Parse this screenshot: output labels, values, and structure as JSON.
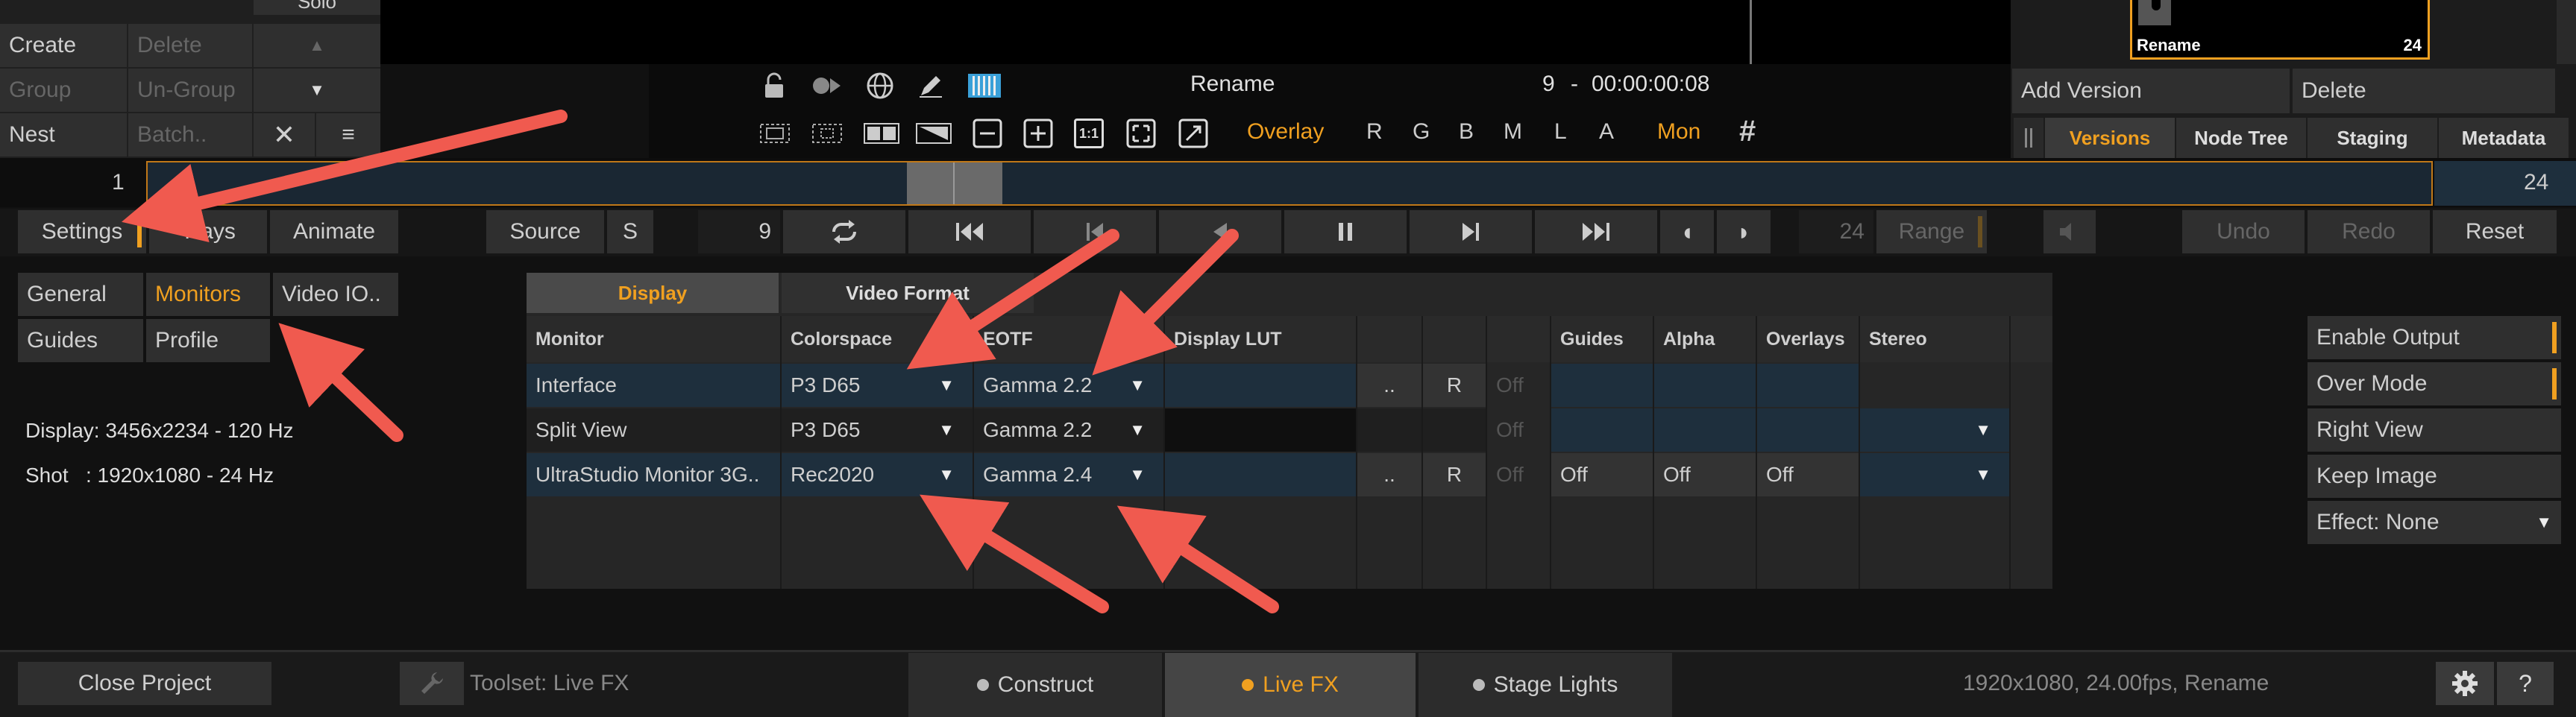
{
  "left_panel": {
    "solo": "Solo",
    "create": "Create",
    "delete": "Delete",
    "group": "Group",
    "ungroup": "Un-Group",
    "nest": "Nest",
    "batch": "Batch.."
  },
  "toolbar": {
    "clip_name": "Rename",
    "frame_number": "9",
    "separator": "-",
    "timecode": "00:00:00:08",
    "overlay": "Overlay",
    "channels": [
      "R",
      "G",
      "B",
      "M",
      "L",
      "A"
    ],
    "mon": "Mon",
    "ratio_label": "1:1"
  },
  "right_panel": {
    "thumb_name": "Rename",
    "thumb_count": "24",
    "add_version": "Add Version",
    "delete": "Delete",
    "tabs": [
      "Versions",
      "Node Tree",
      "Staging",
      "Metadata"
    ]
  },
  "timeline": {
    "start": "1",
    "end": "24"
  },
  "transport": {
    "settings": "Settings",
    "trays": "Trays",
    "animate": "Animate",
    "source": "Source",
    "s": "S",
    "frame": "9",
    "end_frame": "24",
    "range": "Range",
    "undo": "Undo",
    "redo": "Redo",
    "reset": "Reset"
  },
  "settings_tabs": {
    "general": "General",
    "monitors": "Monitors",
    "video_io": "Video IO..",
    "guides": "Guides",
    "profile": "Profile"
  },
  "info": {
    "display": "Display: 3456x2234 - 120 Hz",
    "shot": "Shot   : 1920x1080 - 24 Hz"
  },
  "monitor_table": {
    "tabs": [
      "Display",
      "Video Format"
    ],
    "headers": [
      "Monitor",
      "Colorspace",
      "EOTF",
      "Display LUT",
      "Guides",
      "Alpha",
      "Overlays",
      "Stereo"
    ],
    "rows": [
      {
        "monitor": "Interface",
        "colorspace": "P3 D65",
        "eotf": "Gamma 2.2",
        "dots": "..",
        "r": "R",
        "off": "Off",
        "guides": "",
        "alpha": "",
        "overlays": ""
      },
      {
        "monitor": "Split View",
        "colorspace": "P3 D65",
        "eotf": "Gamma 2.2",
        "dots": "",
        "r": "",
        "off": "Off",
        "guides": "",
        "alpha": "",
        "overlays": ""
      },
      {
        "monitor": "UltraStudio Monitor 3G..",
        "colorspace": "Rec2020",
        "eotf": "Gamma 2.4",
        "dots": "..",
        "r": "R",
        "off": "Off",
        "guides": "Off",
        "alpha": "Off",
        "overlays": "Off"
      }
    ]
  },
  "output_panel": {
    "enable_output": "Enable Output",
    "over_mode": "Over Mode",
    "right_view": "Right View",
    "keep_image": "Keep Image",
    "effect": "Effect: None"
  },
  "bottom_bar": {
    "close_project": "Close Project",
    "toolset": "Toolset: Live FX",
    "tabs": [
      "Construct",
      "Live FX",
      "Stage Lights"
    ],
    "status": "1920x1080, 24.00fps, Rename"
  },
  "colors": {
    "accent": "#f0a020",
    "arrow": "#f05a4f",
    "row_blue": "#1e2f3d"
  }
}
